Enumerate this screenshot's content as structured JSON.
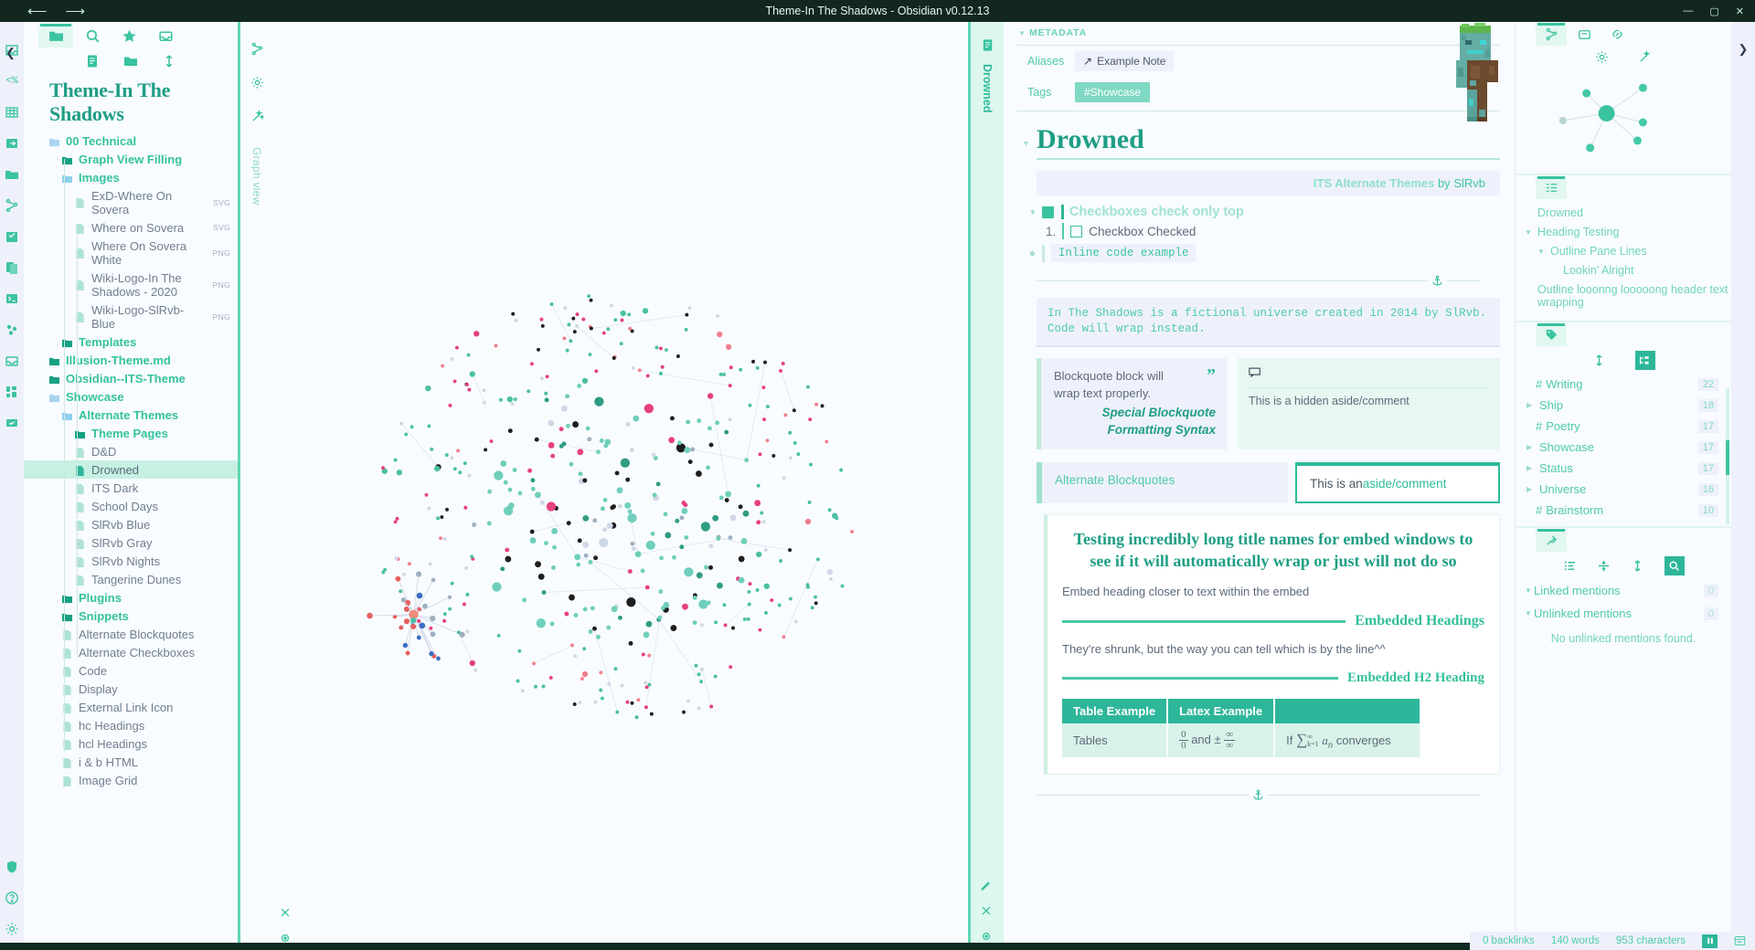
{
  "titlebar": {
    "title": "Theme-In The Shadows - Obsidian v0.12.13",
    "back_icon": "arrow-left-icon",
    "forward_icon": "arrow-right-icon",
    "minimize": "—",
    "maximize": "▢",
    "close": "✕"
  },
  "left_ribbon": {
    "icons": [
      "inbox-icon",
      "percent-code-icon",
      "table-icon",
      "export-icon",
      "calendar-icon",
      "graph-icon",
      "tasks-icon",
      "copy-icon",
      "terminal-icon",
      "molecule-icon",
      "archive-icon",
      "dashboard-icon",
      "send-icon",
      "shield-icon",
      "help-icon",
      "settings-icon"
    ]
  },
  "explorer": {
    "tabs": [
      "folder-icon",
      "search-icon",
      "star-icon",
      "inbox-icon"
    ],
    "tools": [
      "new-note-icon",
      "new-folder-icon",
      "sort-icon"
    ],
    "collapse_icon": "chevron-left-icon",
    "vault_title": "Theme-In The Shadows",
    "tree": [
      {
        "label": "00 Technical",
        "type": "folder",
        "depth": 0,
        "ext": ""
      },
      {
        "label": "Graph View Filling",
        "type": "folder",
        "depth": 1,
        "ext": ""
      },
      {
        "label": "Images",
        "type": "folder",
        "depth": 1,
        "ext": ""
      },
      {
        "label": "ExD-Where On Sovera",
        "type": "file",
        "depth": 2,
        "ext": "SVG"
      },
      {
        "label": "Where on Sovera",
        "type": "file",
        "depth": 2,
        "ext": "SVG"
      },
      {
        "label": "Where On Sovera White",
        "type": "file",
        "depth": 2,
        "ext": "PNG"
      },
      {
        "label": "Wiki-Logo-In The Shadows - 2020",
        "type": "file",
        "depth": 2,
        "ext": "PNG"
      },
      {
        "label": "Wiki-Logo-SlRvb-Blue",
        "type": "file",
        "depth": 2,
        "ext": "PNG"
      },
      {
        "label": "Templates",
        "type": "folder",
        "depth": 1,
        "ext": ""
      },
      {
        "label": "Illusion-Theme.md",
        "type": "folder",
        "depth": 0,
        "ext": ""
      },
      {
        "label": "Obsidian--ITS-Theme",
        "type": "folder",
        "depth": 0,
        "ext": ""
      },
      {
        "label": "Showcase",
        "type": "folder",
        "depth": 0,
        "ext": ""
      },
      {
        "label": "Alternate Themes",
        "type": "folder",
        "depth": 1,
        "ext": ""
      },
      {
        "label": "Theme Pages",
        "type": "folder",
        "depth": 2,
        "ext": ""
      },
      {
        "label": "D&D",
        "type": "file",
        "depth": 2,
        "ext": ""
      },
      {
        "label": "Drowned",
        "type": "file",
        "depth": 2,
        "ext": "",
        "selected": true
      },
      {
        "label": "ITS Dark",
        "type": "file",
        "depth": 2,
        "ext": ""
      },
      {
        "label": "School Days",
        "type": "file",
        "depth": 2,
        "ext": ""
      },
      {
        "label": "SlRvb Blue",
        "type": "file",
        "depth": 2,
        "ext": ""
      },
      {
        "label": "SlRvb Gray",
        "type": "file",
        "depth": 2,
        "ext": ""
      },
      {
        "label": "SlRvb Nights",
        "type": "file",
        "depth": 2,
        "ext": ""
      },
      {
        "label": "Tangerine Dunes",
        "type": "file",
        "depth": 2,
        "ext": ""
      },
      {
        "label": "Plugins",
        "type": "folder",
        "depth": 1,
        "ext": ""
      },
      {
        "label": "Snippets",
        "type": "folder",
        "depth": 1,
        "ext": ""
      },
      {
        "label": "Alternate Blockquotes",
        "type": "file",
        "depth": 1,
        "ext": ""
      },
      {
        "label": "Alternate Checkboxes",
        "type": "file",
        "depth": 1,
        "ext": ""
      },
      {
        "label": "Code",
        "type": "file",
        "depth": 1,
        "ext": ""
      },
      {
        "label": "Display",
        "type": "file",
        "depth": 1,
        "ext": ""
      },
      {
        "label": "External Link Icon",
        "type": "file",
        "depth": 1,
        "ext": ""
      },
      {
        "label": "hc Headings",
        "type": "file",
        "depth": 1,
        "ext": ""
      },
      {
        "label": "hcl Headings",
        "type": "file",
        "depth": 1,
        "ext": ""
      },
      {
        "label": "i & b HTML",
        "type": "file",
        "depth": 1,
        "ext": ""
      },
      {
        "label": "Image Grid",
        "type": "file",
        "depth": 1,
        "ext": ""
      }
    ]
  },
  "graph_pane": {
    "side_icons": [
      "graph-icon",
      "gear-icon",
      "wand-icon"
    ],
    "vertical_title": "Graph view",
    "bottom_icons": [
      "close-icon",
      "target-icon"
    ]
  },
  "editor": {
    "side_icons": [
      "note-icon"
    ],
    "vertical_title": "Drowned",
    "bottom_icons": [
      "pencil-icon",
      "close-icon",
      "target-icon"
    ],
    "metadata": {
      "heading": "METADATA",
      "aliases_key": "Aliases",
      "aliases_value": "Example Note",
      "aliases_icon": "link-arrow-icon",
      "tags_key": "Tags",
      "tags_value": "#Showcase"
    },
    "title": "Drowned",
    "banner_bold": "ITS Alternate Themes",
    "banner_by": " by ",
    "banner_author": "SlRvb",
    "checkbox_section": {
      "heading": "Checkboxes check only top",
      "item_number": "1.",
      "item_label": "Checkbox Checked",
      "inline_code": "Inline code example"
    },
    "codeblock": "In The Shadows is a fictional universe created in 2014 by SlRvb.\nCode will wrap instead.",
    "blockquote": {
      "text": "Blockquote block will wrap text properly.",
      "quote_glyph": "”",
      "special": "Special Blockquote Formatting Syntax"
    },
    "aside": {
      "icon": "comment-icon",
      "text": "This is a hidden aside/comment"
    },
    "alt_blockquote": "Alternate Blockquotes",
    "alt_aside_prefix": "This is an ",
    "alt_aside_link": "aside/comment",
    "embed": {
      "title": "Testing incredibly long title names for embed windows to see if it will automatically wrap or just will not do so",
      "paragraph": "Embed heading closer to text within the embed",
      "h_heading": "Embedded Headings",
      "h_paragraph": "They're shrunk, but the way you can tell which is by the line^^",
      "h2_heading": "Embedded H2 Heading",
      "table": {
        "headers": [
          "Table Example",
          "Latex Example",
          ""
        ],
        "rows": [
          [
            "Tables",
            "0/0 and ±∞/∞",
            "If ∑ k=1 ∞ aₙ converges"
          ]
        ],
        "latex_cell": {
          "num": "0",
          "den": "0",
          "and": "and",
          "pm": "±",
          "inf_num": "∞",
          "inf_den": "∞"
        },
        "latex_cell2": {
          "prefix": "If",
          "sum": "∑",
          "sup": "∞",
          "sub": "k=1",
          "term": "a",
          "term_sub": "n",
          "suffix": "converges"
        }
      }
    }
  },
  "right_sidebar": {
    "graph_panel": {
      "tabs": [
        "graph-icon",
        "archive-icon",
        "link-icon"
      ],
      "tools": [
        "gear-icon",
        "wand-icon"
      ]
    },
    "outline_panel": {
      "tab": "outline-icon",
      "items": [
        {
          "label": "Drowned",
          "depth": 0,
          "tri": false
        },
        {
          "label": "Heading Testing",
          "depth": 0,
          "tri": true
        },
        {
          "label": "Outline Pane Lines",
          "depth": 1,
          "tri": true
        },
        {
          "label": "Lookin' Alright",
          "depth": 2,
          "tri": false
        },
        {
          "label": "Outline looonng looooong header text wrapping",
          "depth": 0,
          "tri": false
        }
      ]
    },
    "tags_panel": {
      "tab": "tag-icon",
      "tools": [
        "sort-icon",
        "tree-icon"
      ],
      "tags": [
        {
          "name": "Writing",
          "count": "22",
          "hash": true
        },
        {
          "name": "Ship",
          "count": "18",
          "hash": false
        },
        {
          "name": "Poetry",
          "count": "17",
          "hash": true
        },
        {
          "name": "Showcase",
          "count": "17",
          "hash": false
        },
        {
          "name": "Status",
          "count": "17",
          "hash": false
        },
        {
          "name": "Universe",
          "count": "16",
          "hash": false
        },
        {
          "name": "Brainstorm",
          "count": "10",
          "hash": true
        }
      ]
    },
    "backlinks_panel": {
      "tab": "backlink-icon",
      "tools": [
        "list-icon",
        "collapse-icon",
        "sort-icon",
        "search-icon"
      ],
      "linked_label": "Linked mentions",
      "linked_count": "0",
      "unlinked_label": "Unlinked mentions",
      "unlinked_count": "0",
      "empty_text": "No unlinked mentions found."
    }
  },
  "far_right_ribbon": {
    "chevron": "chevron-right-icon"
  },
  "statusbar": {
    "backlinks": "0 backlinks",
    "words": "140 words",
    "characters": "953 characters",
    "pause_icon": "pause-icon",
    "panel_icon": "panel-icon"
  },
  "colors": {
    "accent": "#2eb69a",
    "accent_light": "#7fd8c3",
    "bg": "#f8fbff",
    "titlebar": "#11271f",
    "selection": "#c6f0e2"
  }
}
